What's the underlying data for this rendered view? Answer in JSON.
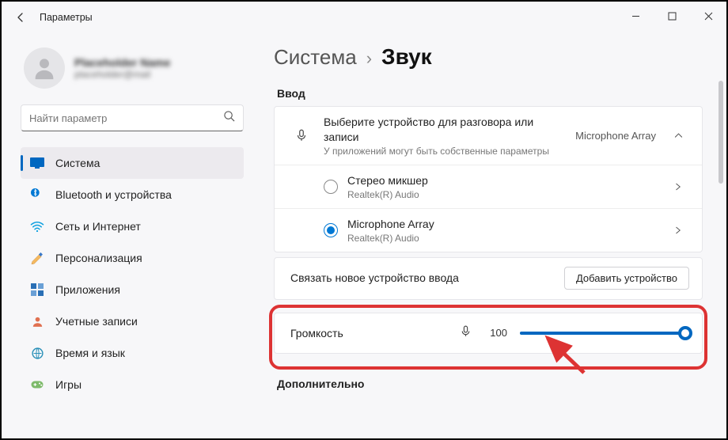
{
  "window": {
    "title": "Параметры"
  },
  "profile": {
    "name": "Placeholder Name",
    "email": "placeholder@mail"
  },
  "search": {
    "placeholder": "Найти параметр"
  },
  "nav": [
    {
      "label": "Система",
      "icon": "system",
      "active": true
    },
    {
      "label": "Bluetooth и устройства",
      "icon": "bluetooth"
    },
    {
      "label": "Сеть и Интернет",
      "icon": "wifi"
    },
    {
      "label": "Персонализация",
      "icon": "personalize"
    },
    {
      "label": "Приложения",
      "icon": "apps"
    },
    {
      "label": "Учетные записи",
      "icon": "accounts"
    },
    {
      "label": "Время и язык",
      "icon": "time"
    },
    {
      "label": "Игры",
      "icon": "games"
    }
  ],
  "breadcrumb": {
    "parent": "Система",
    "current": "Звук"
  },
  "sections": {
    "input": "Ввод",
    "advanced": "Дополнительно"
  },
  "input_card": {
    "title": "Выберите устройство для разговора или записи",
    "sub": "У приложений могут быть собственные параметры",
    "selected": "Microphone Array"
  },
  "devices": [
    {
      "name": "Стерео микшер",
      "driver": "Realtek(R) Audio",
      "selected": false
    },
    {
      "name": "Microphone Array",
      "driver": "Realtek(R) Audio",
      "selected": true
    }
  ],
  "link_new": {
    "label": "Связать новое устройство ввода",
    "button": "Добавить устройство"
  },
  "volume": {
    "label": "Громкость",
    "value": "100"
  }
}
